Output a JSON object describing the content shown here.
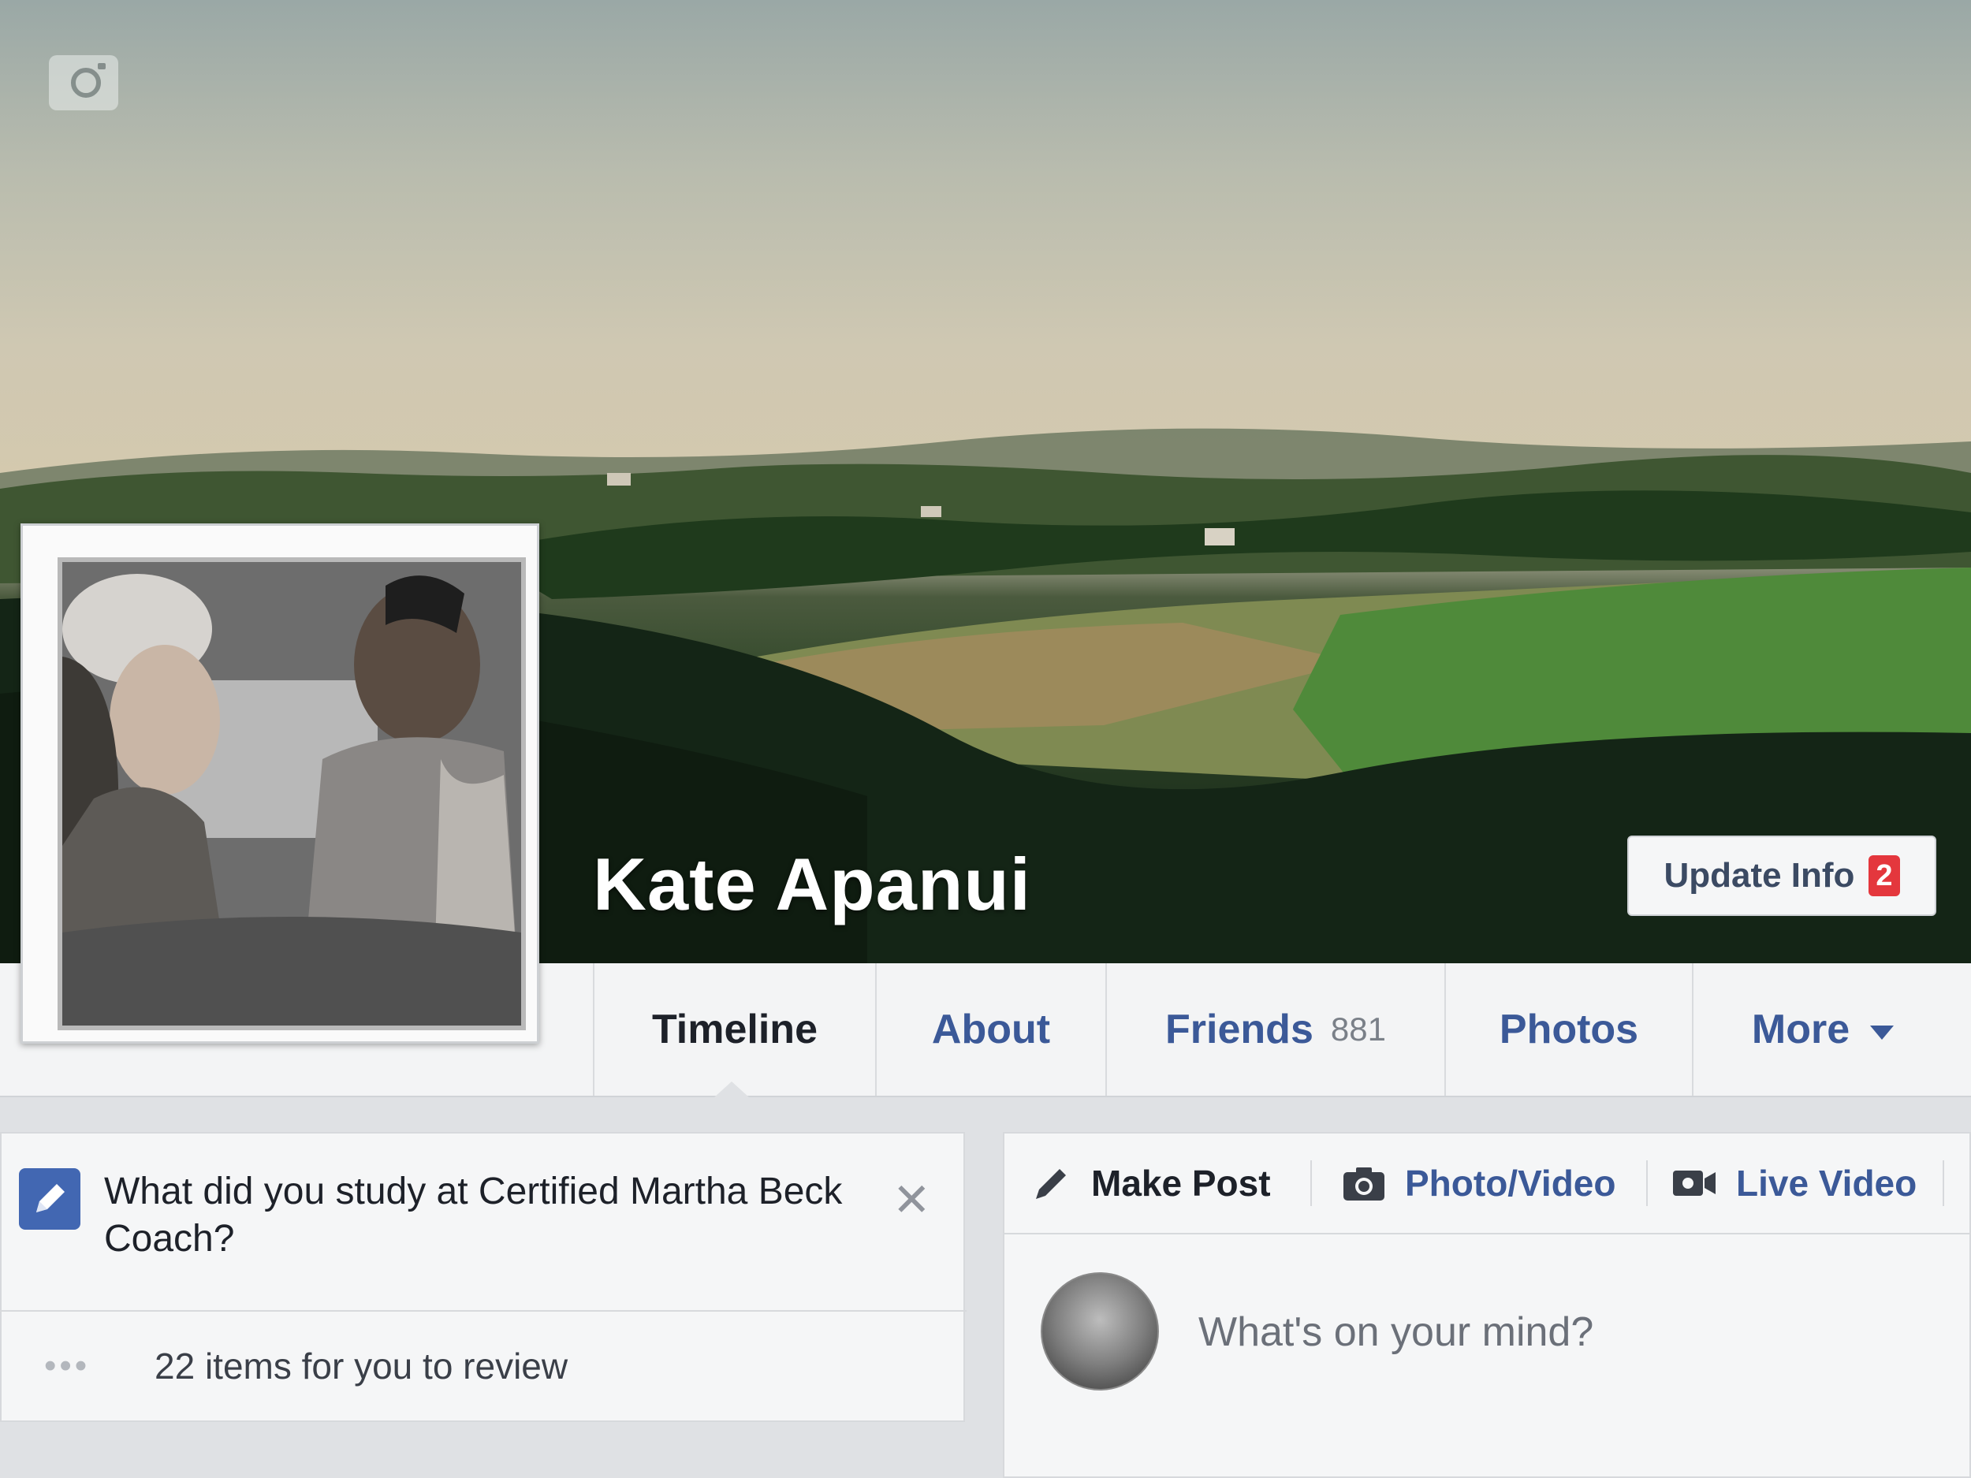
{
  "profile": {
    "name": "Kate Apanui",
    "update_info_label": "Update Info",
    "update_info_badge": "2"
  },
  "nav": {
    "tabs": [
      {
        "label": "Timeline",
        "active": true
      },
      {
        "label": "About"
      },
      {
        "label": "Friends",
        "count": "881"
      },
      {
        "label": "Photos"
      },
      {
        "label": "More"
      }
    ]
  },
  "prompt_card": {
    "question": "What did you study at Certified Martha Beck Coach?",
    "close_glyph": "✕",
    "review_dots": "•••",
    "review_text": "22 items for you to review"
  },
  "composer": {
    "tabs": [
      {
        "label": "Make Post",
        "icon": "pencil-icon"
      },
      {
        "label": "Photo/Video",
        "icon": "camera-icon"
      },
      {
        "label": "Live Video",
        "icon": "video-camera-icon"
      }
    ],
    "placeholder": "What's on your mind?"
  },
  "colors": {
    "link_blue": "#3b5998",
    "badge_red": "#e4373d",
    "accent_blue": "#4267b2"
  }
}
